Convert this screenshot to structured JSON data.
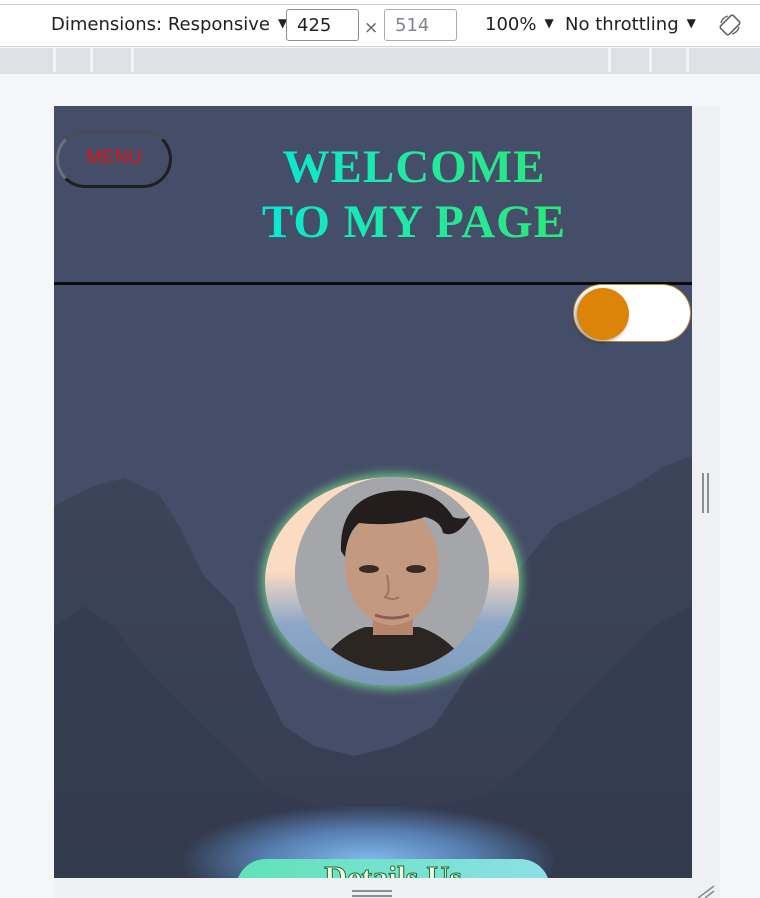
{
  "devtools": {
    "dimensions_label": "Dimensions: Responsive",
    "width_value": "425",
    "height_value": "514",
    "times_sign": "×",
    "zoom_label": "100%",
    "throttling_label": "No throttling"
  },
  "page": {
    "menu_label": "MENU",
    "title_line1": "WELCOME",
    "title_line2": "TO MY PAGE",
    "cta_label": "Details Us",
    "toggle_state": "off"
  },
  "colors": {
    "page_background": "#454e68",
    "menu_text": "#e01010",
    "title_gradient_start": "#00e6e6",
    "title_gradient_end": "#2ee86c",
    "toggle_knob": "#db8408",
    "avatar_glow": "#78e68c"
  },
  "icons": [
    "caret-down-icon",
    "rotate-device-icon",
    "resize-grip-icon"
  ]
}
